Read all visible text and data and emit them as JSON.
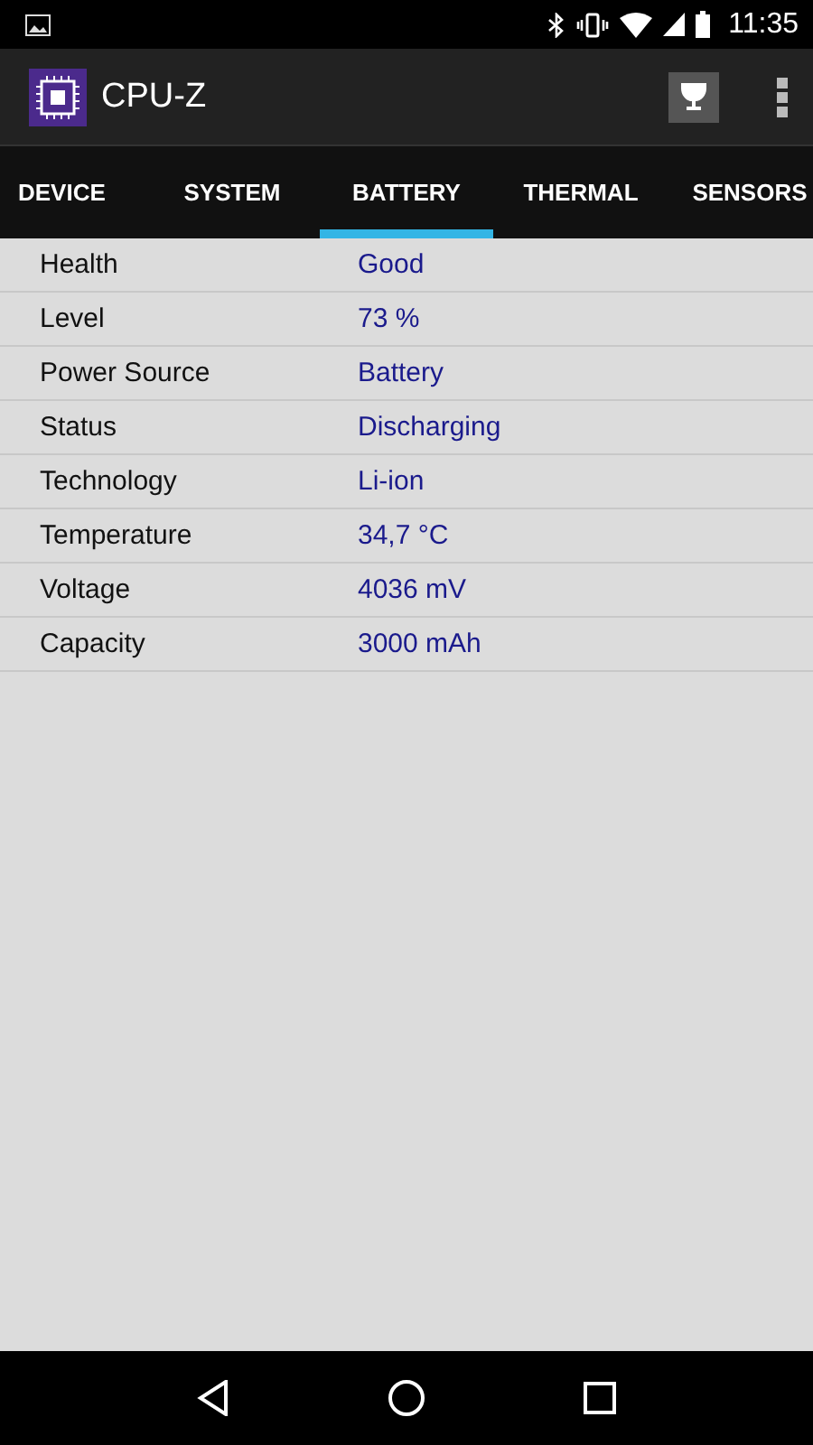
{
  "status_bar": {
    "time": "11:35"
  },
  "app_bar": {
    "title": "CPU-Z"
  },
  "tabs": [
    {
      "label": "DEVICE",
      "selected": false
    },
    {
      "label": "SYSTEM",
      "selected": false
    },
    {
      "label": "BATTERY",
      "selected": true
    },
    {
      "label": "THERMAL",
      "selected": false
    },
    {
      "label": "SENSORS",
      "selected": false
    }
  ],
  "rows": [
    {
      "label": "Health",
      "value": "Good"
    },
    {
      "label": "Level",
      "value": "73 %"
    },
    {
      "label": "Power Source",
      "value": "Battery"
    },
    {
      "label": "Status",
      "value": "Discharging"
    },
    {
      "label": "Technology",
      "value": "Li-ion"
    },
    {
      "label": "Temperature",
      "value": "34,7 °C"
    },
    {
      "label": "Voltage",
      "value": "4036 mV"
    },
    {
      "label": "Capacity",
      "value": "3000 mAh"
    }
  ]
}
